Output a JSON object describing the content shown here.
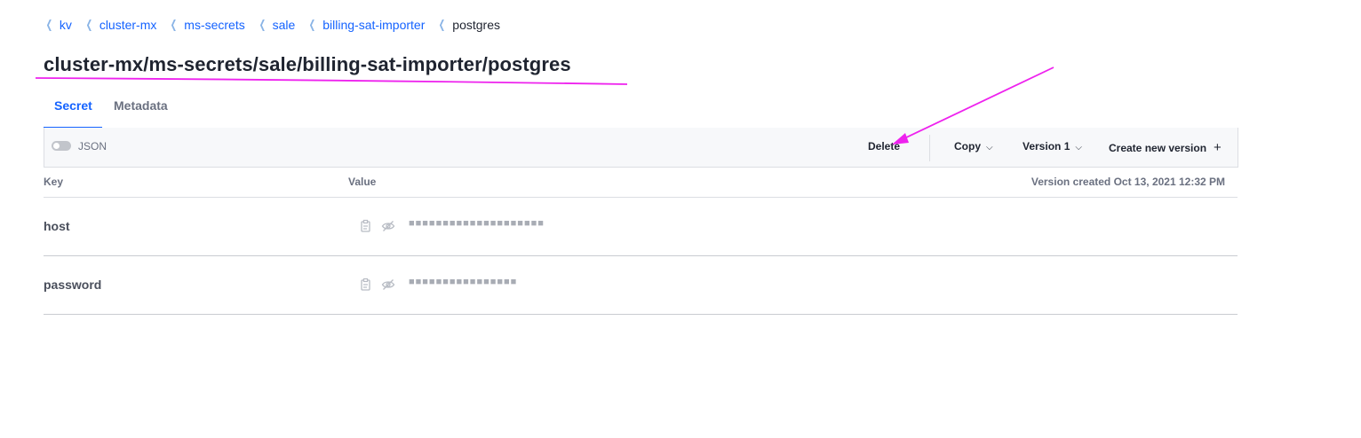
{
  "breadcrumbs": [
    {
      "label": "kv"
    },
    {
      "label": "cluster-mx"
    },
    {
      "label": "ms-secrets"
    },
    {
      "label": "sale"
    },
    {
      "label": "billing-sat-importer"
    },
    {
      "label": "postgres"
    }
  ],
  "page_title": "cluster-mx/ms-secrets/sale/billing-sat-importer/postgres",
  "tabs": [
    {
      "label": "Secret",
      "active": true
    },
    {
      "label": "Metadata",
      "active": false
    }
  ],
  "toolbar": {
    "json_toggle_label": "JSON",
    "json_toggle_on": false,
    "delete_label": "Delete",
    "copy_label": "Copy",
    "version_label": "Version 1",
    "create_version_label": "Create new version"
  },
  "table": {
    "key_header": "Key",
    "value_header": "Value",
    "version_created": "Version created Oct 13, 2021 12:32 PM",
    "rows": [
      {
        "key": "host",
        "masked_value": "■■■■■■■■■■■■■■■■■■■■"
      },
      {
        "key": "password",
        "masked_value": "■■■■■■■■■■■■■■■■"
      }
    ]
  },
  "colors": {
    "link": "#1563ff",
    "annotation": "#ee22ee"
  },
  "icons": {
    "breadcrumb_separator": "chevron-left-icon",
    "copy": "clipboard-icon",
    "reveal": "eye-off-icon",
    "dropdown": "chevron-down-icon",
    "add": "plus-icon"
  }
}
